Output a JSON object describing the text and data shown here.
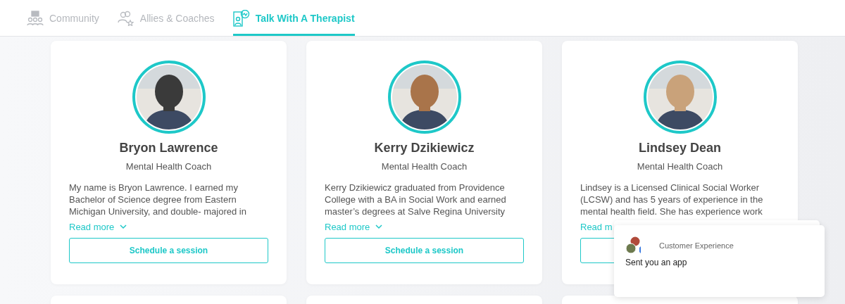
{
  "tabs": [
    {
      "label": "Community",
      "selected": false
    },
    {
      "label": "Allies & Coaches",
      "selected": false
    },
    {
      "label": "Talk With A Therapist",
      "selected": true
    }
  ],
  "cards": [
    {
      "name": "Bryon Lawrence",
      "role": "Mental Health Coach",
      "bio": [
        "My name is Bryon Lawrence. I earned my",
        "Bachelor of Science degree from Eastern",
        "Michigan University, and double- majored in"
      ],
      "read_more": "Read more",
      "chevron": true,
      "button": "Schedule a session"
    },
    {
      "name": "Kerry Dzikiewicz",
      "role": "Mental Health Coach",
      "bio": [
        "Kerry Dzikiewicz graduated from Providence",
        "College with a BA in Social Work and earned",
        "master’s degrees at Salve Regina University"
      ],
      "read_more": "Read more",
      "chevron": true,
      "button": "Schedule a session"
    },
    {
      "name": "Lindsey Dean",
      "role": "Mental Health Coach",
      "bio": [
        "Lindsey is a Licensed Clinical Social Worker",
        "(LCSW) and has 5 years of experience in the",
        "mental health field. She has experience work"
      ],
      "read_more": "Read m",
      "chevron": false
    }
  ],
  "notification": {
    "sender": "Customer Experience",
    "message": "Sent you an app"
  }
}
